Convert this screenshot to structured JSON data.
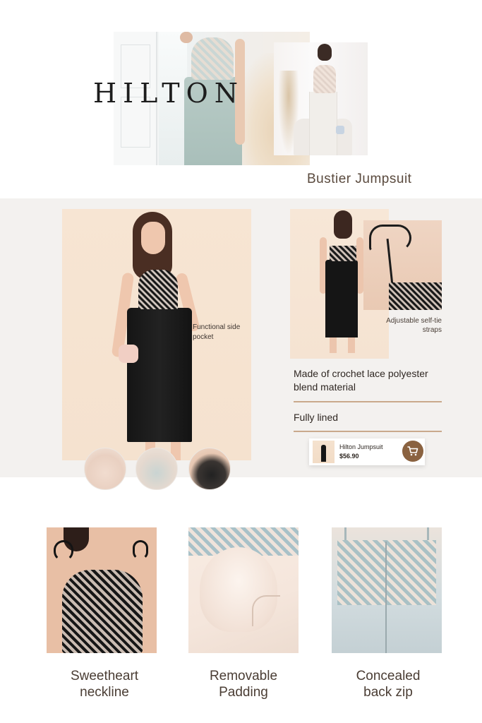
{
  "brand": {
    "logo_text": "HILTON"
  },
  "product": {
    "name": "Bustier Jumpsuit"
  },
  "callouts": {
    "pocket": "Functional side pocket",
    "straps": "Adjustable self-tie straps"
  },
  "details": {
    "material": "Made of crochet lace polyester blend material",
    "lining": "Fully lined"
  },
  "cart": {
    "item_name": "Hilton Jumpsuit",
    "price": "$56.90",
    "icon": "cart-icon"
  },
  "color_swatches": [
    {
      "name": "blush",
      "color": "#e9d0c1"
    },
    {
      "name": "mint",
      "color": "#c9d4d2"
    },
    {
      "name": "black",
      "color": "#222222"
    }
  ],
  "features": [
    {
      "label_line1": "Sweetheart",
      "label_line2": "neckline"
    },
    {
      "label_line1": "Removable",
      "label_line2": "Padding"
    },
    {
      "label_line1": "Concealed",
      "label_line2": "back zip"
    }
  ],
  "colors": {
    "accent": "#8a6240",
    "divider": "#c9a98c",
    "band_background": "#f3f1ef"
  }
}
